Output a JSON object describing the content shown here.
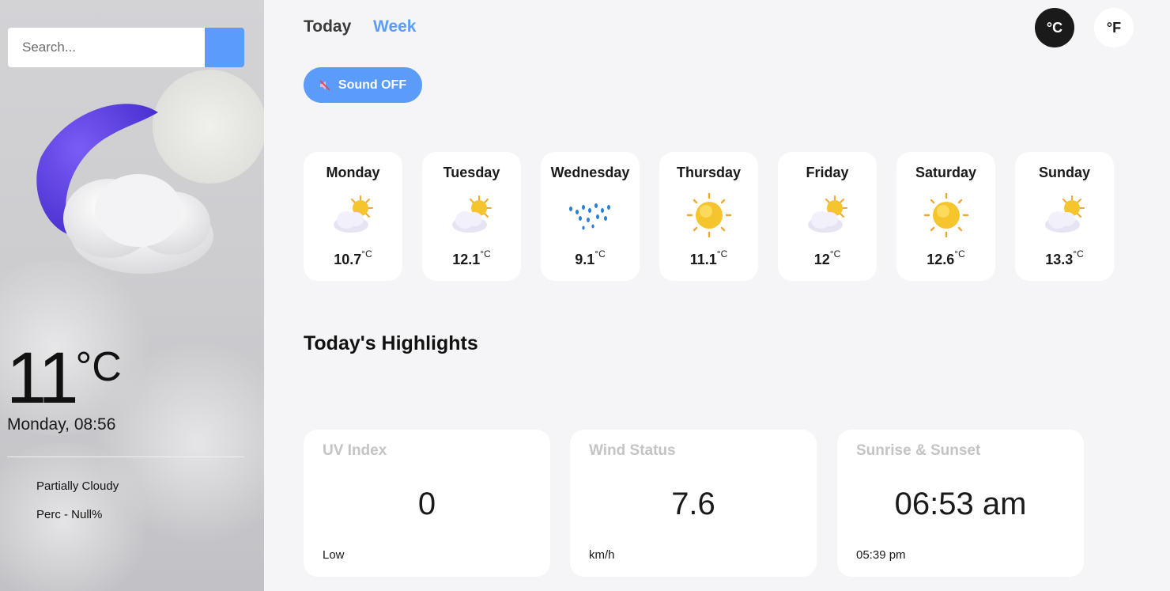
{
  "sidebar": {
    "search": {
      "placeholder": "Search...",
      "value": ""
    },
    "search_button_color": "#5b9bf9",
    "current_icon": "moon-cloud-icon",
    "temperature": "11",
    "temperature_unit": "°C",
    "day_time": "Monday, 08:56",
    "condition": "Partially Cloudy",
    "precipitation": "Perc - Null%"
  },
  "header": {
    "tabs": [
      {
        "label": "Today",
        "active": false
      },
      {
        "label": "Week",
        "active": true
      }
    ],
    "units": [
      {
        "label": "°C",
        "active": true
      },
      {
        "label": "°F",
        "active": false
      }
    ],
    "sound_button": {
      "label": "Sound OFF",
      "icon": "muted-speaker-icon"
    }
  },
  "week": [
    {
      "day": "Monday",
      "temp": "10.7",
      "unit": "°C",
      "icon": "partly-cloudy-icon"
    },
    {
      "day": "Tuesday",
      "temp": "12.1",
      "unit": "°C",
      "icon": "partly-cloudy-icon"
    },
    {
      "day": "Wednesday",
      "temp": "9.1",
      "unit": "°C",
      "icon": "rain-icon"
    },
    {
      "day": "Thursday",
      "temp": "11.1",
      "unit": "°C",
      "icon": "sun-icon"
    },
    {
      "day": "Friday",
      "temp": "12",
      "unit": "°C",
      "icon": "partly-cloudy-icon"
    },
    {
      "day": "Saturday",
      "temp": "12.6",
      "unit": "°C",
      "icon": "sun-icon"
    },
    {
      "day": "Sunday",
      "temp": "13.3",
      "unit": "°C",
      "icon": "partly-cloudy-icon"
    }
  ],
  "highlights": {
    "title": "Today's Highlights",
    "cards": [
      {
        "label": "UV Index",
        "value": "0",
        "sub": "Low"
      },
      {
        "label": "Wind Status",
        "value": "7.6",
        "sub": "km/h"
      },
      {
        "label": "Sunrise & Sunset",
        "value": "06:53 am",
        "sub": "05:39 pm"
      }
    ]
  },
  "colors": {
    "accent": "#5b9bf9",
    "active_unit_bg": "#1a1a1a",
    "highlight_label": "#c4c4c4",
    "moon": "#5b3ee0"
  }
}
